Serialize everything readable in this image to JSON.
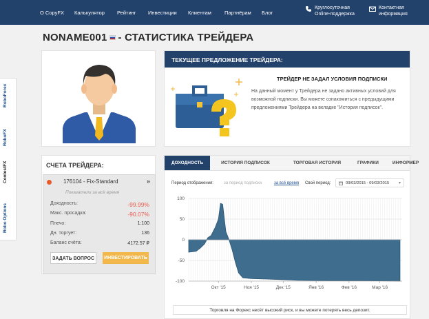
{
  "nav": {
    "items": [
      "О CopyFX",
      "Калькулятор",
      "Рейтинг",
      "Инвестиции",
      "Клиентам",
      "Партнёрам",
      "Блог"
    ],
    "support": [
      "Круглосуточная",
      "Online-поддержка"
    ],
    "contacts": [
      "Контактная",
      "информация"
    ]
  },
  "side_tabs": [
    "RoboForex",
    "RoboFX",
    "ContestFX",
    "Robo Options"
  ],
  "page": {
    "trader_name": "NONAME001",
    "title_suffix": "- СТАТИСТИКА ТРЕЙДЕРА"
  },
  "offer": {
    "header": "ТЕКУЩЕЕ ПРЕДЛОЖЕНИЕ ТРЕЙДЕРА:",
    "title": "ТРЕЙДЕР НЕ ЗАДАЛ УСЛОВИЯ ПОДПИСКИ",
    "text": "На данный момент у Трейдера не задано активных условий для возможной подписки. Вы можете ознакомиться с предыдущими предложениями Трейдера на вкладке \"История подписок\"."
  },
  "accounts": {
    "header": "СЧЕТА ТРЕЙДЕРА:",
    "account_id": "176104 - Fix-Standard",
    "all_time": "Показатели за всё время",
    "rows": [
      {
        "label": "Доходность:",
        "value": "-99.99%",
        "red": true
      },
      {
        "label": "Макс. просадка:",
        "value": "-90.07%",
        "red": true
      },
      {
        "label": "Плечо:",
        "value": "1:100",
        "red": false
      },
      {
        "label": "Дн. торгует:",
        "value": "136",
        "red": false
      },
      {
        "label": "Баланс счёта:",
        "value": "4172.57 ₽",
        "red": false
      }
    ],
    "ask_button": "ЗАДАТЬ ВОПРОС",
    "invest_button": "ИНВЕСТИРОВАТЬ",
    "status_color": "#e85a2a"
  },
  "stats": {
    "tabs": [
      "ДОХОДНОСТЬ",
      "ИСТОРИЯ ПОДПИСОК",
      "ТОРГОВАЯ ИСТОРИЯ",
      "ГРАФИКИ",
      "ИНФОРМЕР"
    ],
    "active_tab": 0,
    "period_label": "Период отображения:",
    "period_sub": "за период подписки",
    "period_all": "за всё время",
    "own_period": "Свой период:",
    "date_range": "09/03/2015 - 09/03/2015",
    "notice": "Торговля на Форекс несёт высокий риск, и вы можете потерять весь депозит."
  },
  "colors": {
    "brand": "#22416b",
    "accent": "#f2b84b",
    "chart": "#3f6d8d"
  },
  "chart_data": {
    "type": "area",
    "title": "",
    "xlabel": "",
    "ylabel": "",
    "x_tick_labels": [
      "Окт '15",
      "Ноя '15",
      "Дек '15",
      "Янв '16",
      "Фев '16",
      "Мар '16"
    ],
    "x_tick_dates": [
      "2015-10-01",
      "2015-11-01",
      "2015-12-01",
      "2016-01-01",
      "2016-02-01",
      "2016-03-01"
    ],
    "ylim": [
      -100,
      100
    ],
    "y_ticks": [
      100,
      50,
      0,
      -50,
      -100
    ],
    "grid": true,
    "series": [
      {
        "x": [
          "2015-09-03",
          "2015-09-10",
          "2015-09-14",
          "2015-09-18",
          "2015-09-21",
          "2015-09-24",
          "2015-09-28",
          "2015-10-01",
          "2015-10-03",
          "2015-10-05",
          "2015-10-08",
          "2015-10-11",
          "2015-10-14",
          "2015-10-17",
          "2015-10-20",
          "2015-10-24",
          "2015-11-01",
          "2015-11-15",
          "2015-12-15",
          "2016-01-15",
          "2016-02-15",
          "2016-03-20"
        ],
        "values": [
          -30,
          -28,
          -20,
          -10,
          5,
          10,
          30,
          50,
          88,
          86,
          20,
          0,
          -25,
          -55,
          -80,
          -92,
          -94,
          -95,
          -98,
          -99,
          -99,
          -99.99
        ]
      }
    ]
  }
}
